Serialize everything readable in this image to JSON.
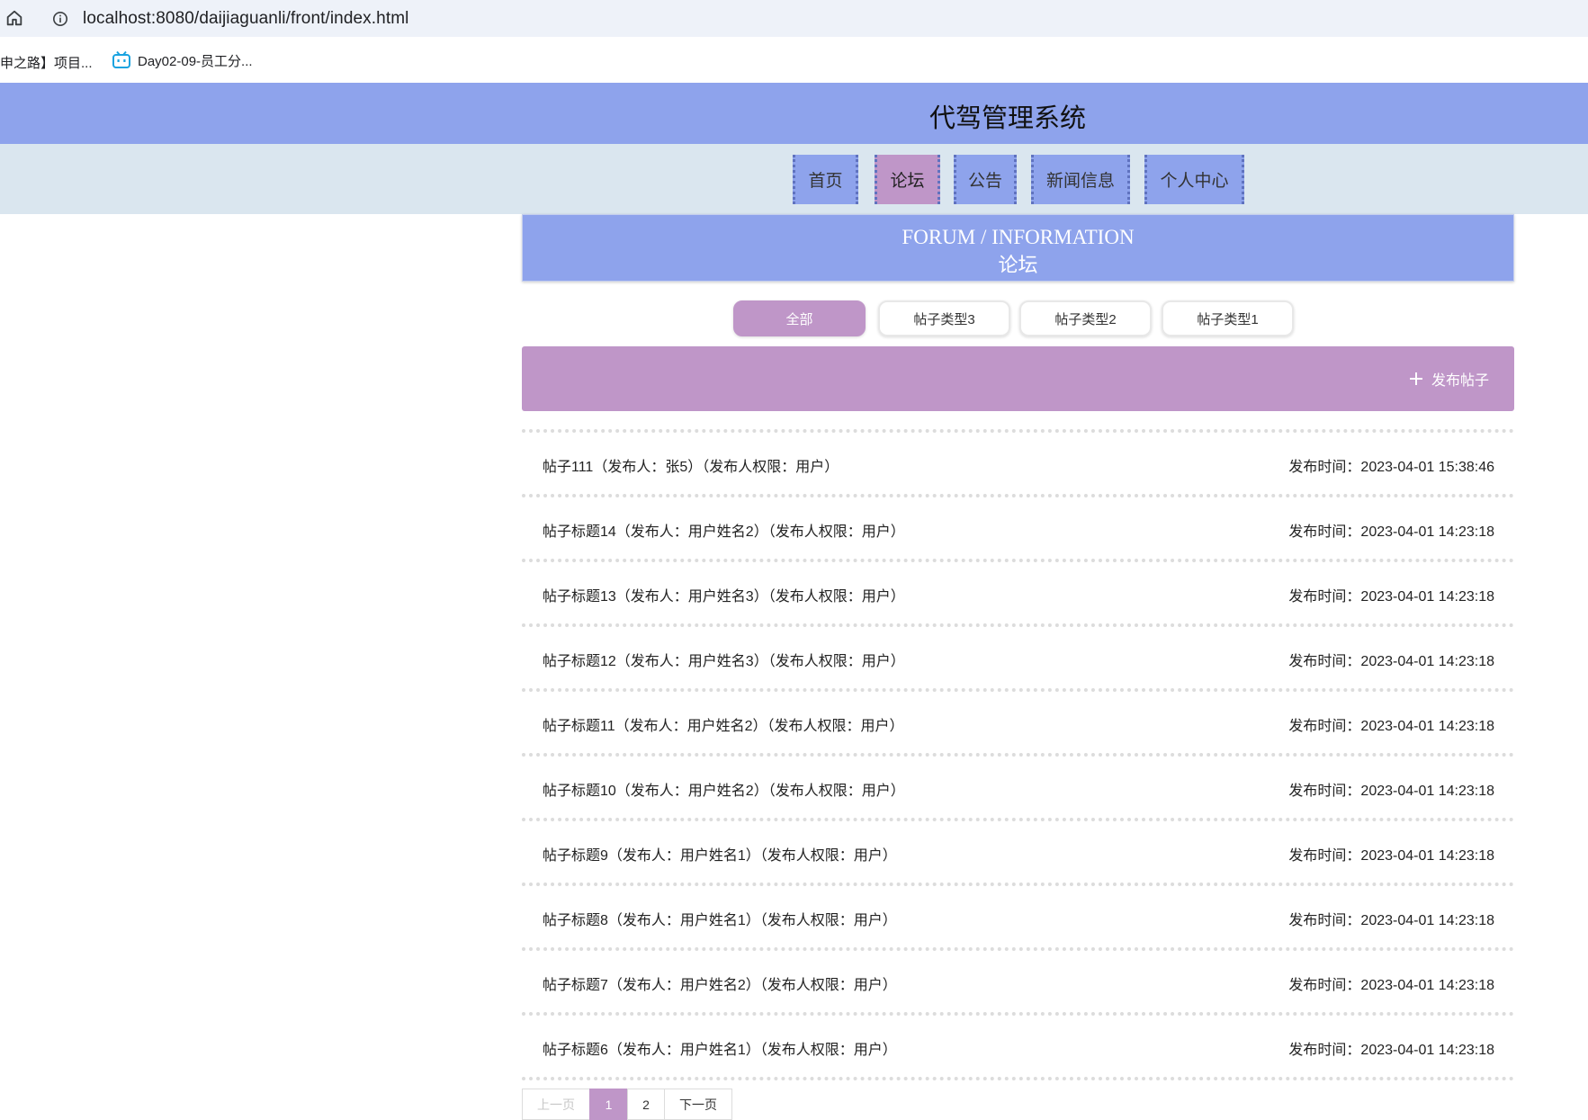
{
  "browser": {
    "url": "localhost:8080/daijiaguanli/front/index.html",
    "bookmarks": [
      "申之路】项目...",
      "Day02-09-员工分..."
    ]
  },
  "site": {
    "title": "代驾管理系统"
  },
  "nav": [
    "首页",
    "论坛",
    "公告",
    "新闻信息",
    "个人中心"
  ],
  "nav_active": "论坛",
  "banner": {
    "en": "FORUM / INFORMATION",
    "cn": "论坛"
  },
  "categories": [
    "全部",
    "帖子类型3",
    "帖子类型2",
    "帖子类型1"
  ],
  "category_active": "全部",
  "post_button": "发布帖子",
  "posts": [
    {
      "title": "帖子111（发布人：张5）（发布人权限：用户）",
      "time": "发布时间：2023-04-01 15:38:46"
    },
    {
      "title": "帖子标题14（发布人：用户姓名2）（发布人权限：用户）",
      "time": "发布时间：2023-04-01 14:23:18"
    },
    {
      "title": "帖子标题13（发布人：用户姓名3）（发布人权限：用户）",
      "time": "发布时间：2023-04-01 14:23:18"
    },
    {
      "title": "帖子标题12（发布人：用户姓名3）（发布人权限：用户）",
      "time": "发布时间：2023-04-01 14:23:18"
    },
    {
      "title": "帖子标题11（发布人：用户姓名2）（发布人权限：用户）",
      "time": "发布时间：2023-04-01 14:23:18"
    },
    {
      "title": "帖子标题10（发布人：用户姓名2）（发布人权限：用户）",
      "time": "发布时间：2023-04-01 14:23:18"
    },
    {
      "title": "帖子标题9（发布人：用户姓名1）（发布人权限：用户）",
      "time": "发布时间：2023-04-01 14:23:18"
    },
    {
      "title": "帖子标题8（发布人：用户姓名1）（发布人权限：用户）",
      "time": "发布时间：2023-04-01 14:23:18"
    },
    {
      "title": "帖子标题7（发布人：用户姓名2）（发布人权限：用户）",
      "time": "发布时间：2023-04-01 14:23:18"
    },
    {
      "title": "帖子标题6（发布人：用户姓名1）（发布人权限：用户）",
      "time": "发布时间：2023-04-01 14:23:18"
    }
  ],
  "pagination": {
    "prev": "上一页",
    "pages": [
      "1",
      "2"
    ],
    "current": "1",
    "next": "下一页"
  },
  "colors": {
    "header_bg": "#8ea3ec",
    "nav_bg": "#dae6ef",
    "accent": "#bf96c8"
  }
}
